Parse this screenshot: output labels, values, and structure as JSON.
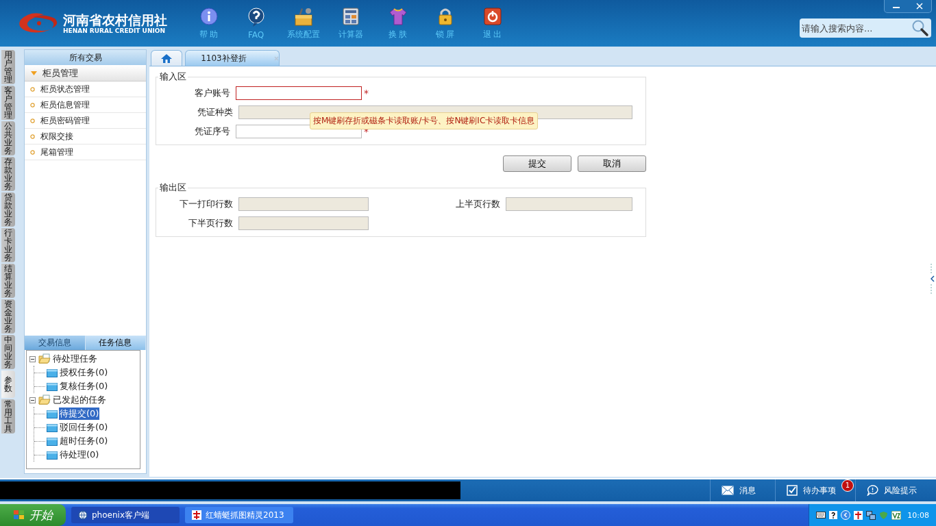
{
  "header": {
    "logo_title": "河南省农村信用社",
    "logo_subtitle": "HENAN RURAL CREDIT UNION"
  },
  "toolbar": [
    {
      "label": "帮 助",
      "kind": "info"
    },
    {
      "label": "FAQ",
      "kind": "help"
    },
    {
      "label": "系统配置",
      "kind": "toolbox"
    },
    {
      "label": "计算器",
      "kind": "calculator"
    },
    {
      "label": "换 肤",
      "kind": "shirt"
    },
    {
      "label": "锁 屏",
      "kind": "lock"
    },
    {
      "label": "退 出",
      "kind": "power"
    }
  ],
  "search": {
    "placeholder": "请输入搜索内容..."
  },
  "side_tabs": [
    {
      "label": "用户管理",
      "selected": false
    },
    {
      "label": "客户管理",
      "selected": false
    },
    {
      "label": "公共业务",
      "selected": false
    },
    {
      "label": "存款业务",
      "selected": false
    },
    {
      "label": "贷款业务",
      "selected": false
    },
    {
      "label": "行卡业务",
      "selected": false
    },
    {
      "label": "结算业务",
      "selected": false
    },
    {
      "label": "资金业务",
      "selected": false
    },
    {
      "label": "中间业务",
      "selected": false
    },
    {
      "label": "参数",
      "selected": true
    },
    {
      "label": "常用工具",
      "selected": false
    }
  ],
  "menu": {
    "header": "所有交易",
    "group": {
      "label": "柜员管理",
      "expanded": true
    },
    "items": [
      "柜员状态管理",
      "柜员信息管理",
      "柜员密码管理",
      "权限交接",
      "尾箱管理"
    ]
  },
  "info_tabs": [
    {
      "label": "交易信息",
      "selected": false
    },
    {
      "label": "任务信息",
      "selected": true
    }
  ],
  "tree": [
    {
      "label": "待处理任务",
      "expanded": true,
      "children": [
        {
          "label": "授权任务(0)",
          "selected": false
        },
        {
          "label": "复核任务(0)",
          "selected": false
        }
      ]
    },
    {
      "label": "已发起的任务",
      "expanded": true,
      "children": [
        {
          "label": "待提交(0)",
          "selected": true
        },
        {
          "label": "驳回任务(0)",
          "selected": false
        },
        {
          "label": "超时任务(0)",
          "selected": false
        },
        {
          "label": "待处理(0)",
          "selected": false
        }
      ]
    }
  ],
  "tabs": [
    {
      "kind": "home",
      "selected": false
    },
    {
      "kind": "page",
      "label": "1103补登折",
      "selected": true
    }
  ],
  "input_section": {
    "title": "输入区",
    "fields": [
      {
        "label": "客户账号",
        "kind": "input",
        "invalid": true,
        "mark": "*",
        "wide": false
      },
      {
        "label": "凭证种类",
        "kind": "display",
        "invalid": false,
        "wide": true
      },
      {
        "label": "凭证序号",
        "kind": "input",
        "invalid": false,
        "mark": "*",
        "wide": false
      }
    ],
    "tooltip": "按M键刷存折或磁条卡读取账/卡号、按N键刷IC卡读取卡信息"
  },
  "buttons": [
    "提交",
    "取消"
  ],
  "output_section": {
    "title": "输出区",
    "fields": [
      {
        "label": "下一打印行数",
        "kind": "display",
        "invalid": false,
        "wide": false
      },
      {
        "label": "上半页行数",
        "kind": "display",
        "invalid": false,
        "wide": false
      },
      {
        "label": "下半页行数",
        "kind": "display",
        "invalid": false,
        "wide": false
      }
    ]
  },
  "status_bar": [
    {
      "label": "消息",
      "kind": "mail"
    },
    {
      "label": "待办事项",
      "kind": "todo",
      "badge": "1"
    },
    {
      "label": "风险提示",
      "kind": "chat"
    }
  ],
  "taskbar": {
    "start": "开始",
    "tasks": [
      {
        "label": "phoenix客户端",
        "selected": true,
        "kind": "globe"
      },
      {
        "label": "红蜻蜓抓图精灵2013",
        "selected": false,
        "kind": "red"
      }
    ],
    "clock": "10:08"
  }
}
